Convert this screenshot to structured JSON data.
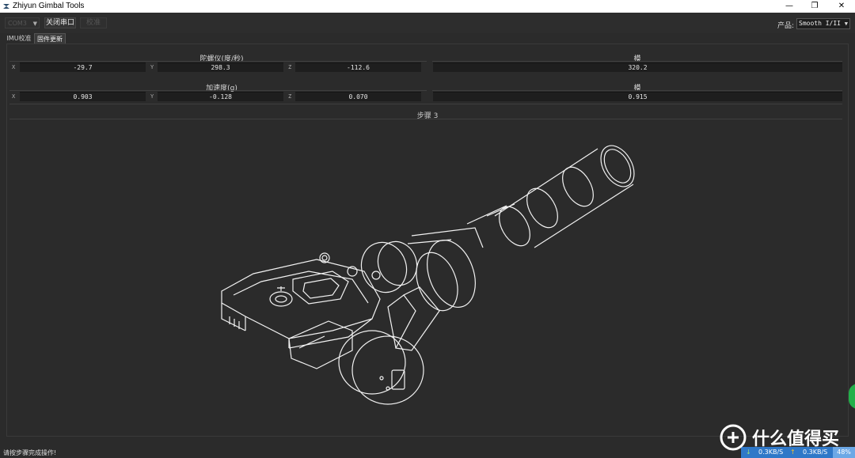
{
  "window": {
    "title": "Zhiyun Gimbal Tools"
  },
  "toolbar": {
    "port_combo_value": "COM3",
    "close_port_label": "关闭串口",
    "calibrate_label": "校准",
    "product_label": "产品:",
    "product_value": "Smooth I/II"
  },
  "tabs": [
    {
      "label": "IMU校准",
      "active": false
    },
    {
      "label": "固件更新",
      "active": true
    }
  ],
  "gyro": {
    "title": "陀螺仪(度/秒)",
    "x_label": "X",
    "x_value": "-29.7",
    "y_label": "Y",
    "y_value": "298.3",
    "z_label": "Z",
    "z_value": "-112.6",
    "norm_title": "模",
    "norm_value": "320.2"
  },
  "accel": {
    "title": "加速度(g)",
    "x_label": "X",
    "x_value": "0.903",
    "y_label": "Y",
    "y_value": "-0.128",
    "z_label": "Z",
    "z_value": "0.070",
    "norm_title": "模",
    "norm_value": "0.915"
  },
  "step": {
    "label": "步骤 3"
  },
  "status": {
    "message": "请按步骤完成操作!"
  },
  "network": {
    "down": "0.3KB/S",
    "up": "0.3KB/S",
    "percent": "48%"
  },
  "watermark": {
    "text": "什么值得买"
  },
  "colors": {
    "background": "#2b2b2b",
    "field": "#1e1e1e",
    "netbar": "#2f78c8"
  }
}
